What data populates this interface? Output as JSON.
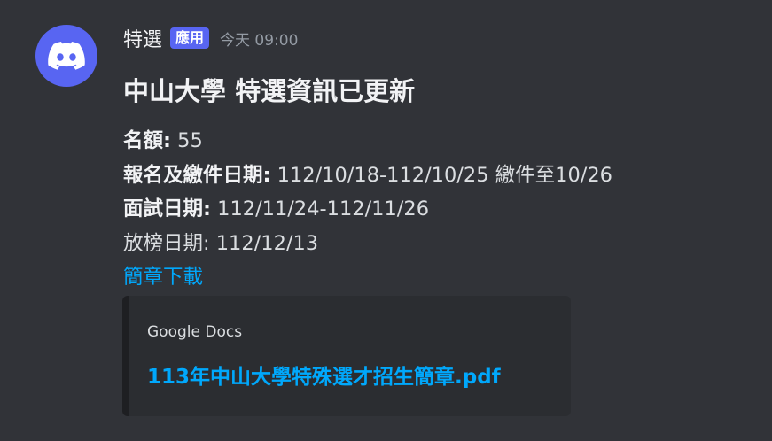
{
  "message": {
    "username": "特選",
    "badge": "應用",
    "timestamp": "今天 09:00",
    "avatar_icon": "discord-logo-icon",
    "avatar_color": "#5865f2",
    "title": "中山大學 特選資訊已更新",
    "fields": [
      {
        "label": "名額:",
        "value": " 55"
      },
      {
        "label": "報名及繳件日期:",
        "value": " 112/10/18-112/10/25 繳件至10/26"
      },
      {
        "label": "面試日期:",
        "value": " 112/11/24-112/11/26"
      }
    ],
    "release_date": "放榜日期: 112/12/13",
    "download_link": "簡章下載",
    "embed": {
      "provider": "Google Docs",
      "title": "113年中山大學特殊選才招生簡章.pdf"
    }
  },
  "colors": {
    "background": "#313338",
    "link": "#00a8fc",
    "brand": "#5865f2",
    "embed_bg": "#2b2d31"
  }
}
